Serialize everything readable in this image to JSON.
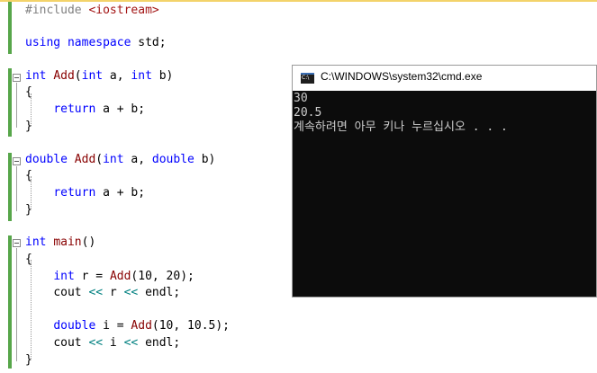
{
  "editor": {
    "line1": "#include",
    "line1_header": "<iostream>",
    "using_kw": "using",
    "namespace_kw": "namespace",
    "namespace_name": "std;",
    "add1": {
      "ret": "int",
      "name": "Add",
      "p_open": "(",
      "t1": "int",
      "a": " a, ",
      "t2": "int",
      "b": " b)"
    },
    "add2": {
      "ret": "double",
      "name": "Add",
      "p_open": "(",
      "t1": "int",
      "a": " a, ",
      "t2": "double",
      "b": " b)"
    },
    "open_brace": "{",
    "close_brace": "}",
    "return_kw": "return",
    "return_expr": " a + b;",
    "main": {
      "ret": "int",
      "name": "main",
      "rest": "()"
    },
    "stmt1": {
      "type": "int",
      "decl": " r = ",
      "call": "Add",
      "args": "(10, 20);"
    },
    "stmt2": {
      "a": "cout ",
      "op1": "<<",
      "b": " r ",
      "op2": "<<",
      "c": " endl;"
    },
    "stmt3": {
      "type": "double",
      "decl": " i = ",
      "call": "Add",
      "args": "(10, 10.5);"
    },
    "stmt4": {
      "a": "cout ",
      "op1": "<<",
      "b": " i ",
      "op2": "<<",
      "c": " endl;"
    }
  },
  "console": {
    "title": "C:\\WINDOWS\\system32\\cmd.exe",
    "icon": "cmd-icon",
    "output": [
      "30",
      "20.5",
      "계속하려면 아무 키나 누르십시오 . . ."
    ]
  },
  "colors": {
    "keyword": "#0000ff",
    "string": "#a31515",
    "function": "#880000",
    "operator": "#008080",
    "change_bar": "#57a64a",
    "console_bg": "#0c0c0c",
    "console_text": "#cccccc"
  }
}
